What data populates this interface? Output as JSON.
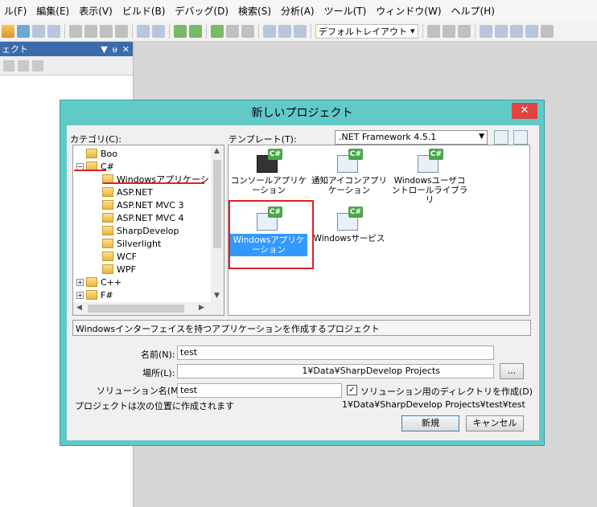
{
  "menubar": [
    "ル(F)",
    "編集(E)",
    "表示(V)",
    "ビルド(B)",
    "デバッグ(D)",
    "検索(S)",
    "分析(A)",
    "ツール(T)",
    "ウィンドウ(W)",
    "ヘルプ(H)"
  ],
  "toolbar": {
    "layout_combo": "デフォルトレイアウト"
  },
  "left_panel": {
    "title": "ェクト",
    "pin": "ᵾ",
    "close": "✕",
    "dropdown": "▼"
  },
  "dialog": {
    "title": "新しいプロジェクト",
    "close": "✕",
    "category_label": "カテゴリ(C):",
    "template_label": "テンプレート(T):",
    "framework": ".NET Framework 4.5.1",
    "tree": [
      {
        "label": "Boo",
        "expander": ""
      },
      {
        "label": "C#",
        "expander": "−"
      },
      {
        "label": "Windowsアプリケーショ",
        "expander": ""
      },
      {
        "label": "ASP.NET",
        "expander": ""
      },
      {
        "label": "ASP.NET MVC 3",
        "expander": ""
      },
      {
        "label": "ASP.NET MVC 4",
        "expander": ""
      },
      {
        "label": "SharpDevelop",
        "expander": ""
      },
      {
        "label": "Silverlight",
        "expander": ""
      },
      {
        "label": "WCF",
        "expander": ""
      },
      {
        "label": "WPF",
        "expander": ""
      },
      {
        "label": "C++",
        "expander": "+"
      },
      {
        "label": "F#",
        "expander": "+"
      }
    ],
    "templates": [
      {
        "label": "コンソールアプリケーション"
      },
      {
        "label": "通知アイコンアプリケーション"
      },
      {
        "label": "Windowsユーザコントロールライブラリ"
      },
      {
        "label": "Windowsアプリケーション"
      },
      {
        "label": "Windowsサービス"
      }
    ],
    "badge": "C#",
    "description": "Windowsインターフェイスを持つアプリケーションを作成するプロジェクト",
    "name_label": "名前(N):",
    "name_value": "test",
    "location_label": "場所(L):",
    "location_value": "1¥Data¥SharpDevelop Projects",
    "browse": "...",
    "solution_label": "ソリューション名(M):",
    "solution_value": "test",
    "create_dir_label": "ソリューション用のディレクトリを作成(D)",
    "create_dir_checked": "✓",
    "path_label": "プロジェクトは次の位置に作成されます",
    "path_value": "1¥Data¥SharpDevelop Projects¥test¥test",
    "new_button": "新規",
    "cancel_button": "キャンセル"
  },
  "colors": {
    "dialog_frame": "#62c9c9",
    "close_button": "#e04343",
    "selection": "#3399ff",
    "annotation_red": "#e02020"
  }
}
